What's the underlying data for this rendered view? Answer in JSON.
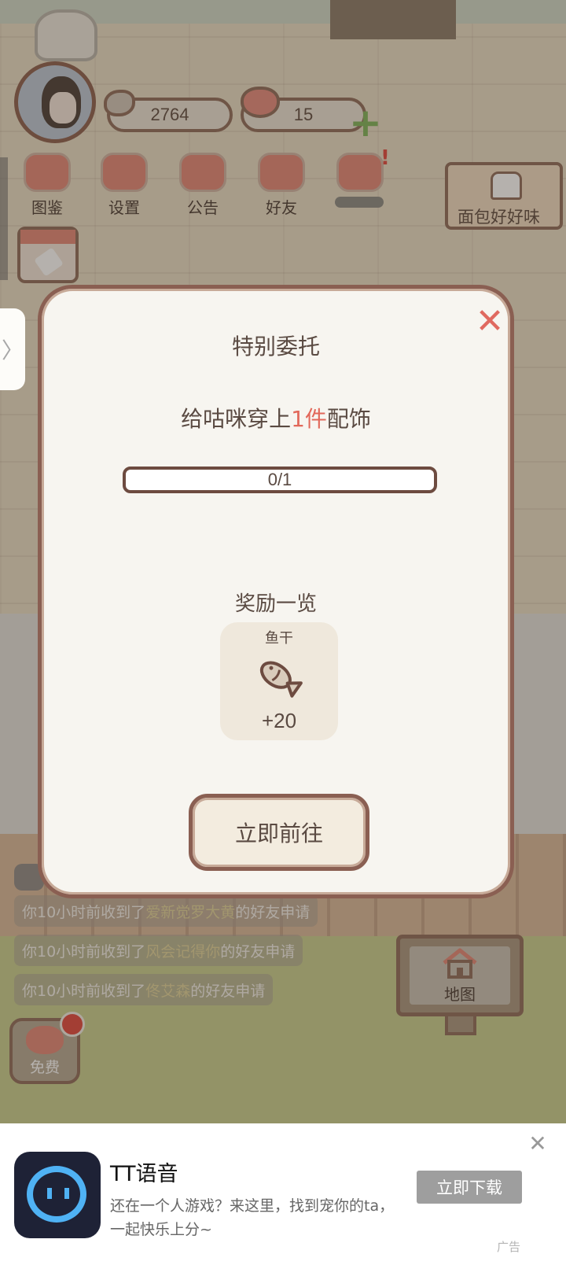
{
  "hud": {
    "fish_count": "2764",
    "heart_count": "15",
    "menu": [
      {
        "label": "图鉴"
      },
      {
        "label": "设置"
      },
      {
        "label": "公告"
      },
      {
        "label": "好友"
      }
    ],
    "shop_sign": "面包好好味",
    "side_tab": "〉"
  },
  "notices": [
    {
      "prefix": "你10小时前收到了",
      "name": "爱新觉罗大黄",
      "suffix": "的好友申请"
    },
    {
      "prefix": "你10小时前收到了",
      "name": "风会记得你",
      "suffix": "的好友申请"
    },
    {
      "prefix": "你10小时前收到了",
      "name": "佟艾森",
      "suffix": "的好友申请"
    }
  ],
  "map_button": "地图",
  "free_button": "免费",
  "modal": {
    "title": "特别委托",
    "close": "✕",
    "task_prefix": "给咕咪穿上",
    "task_highlight": "1件",
    "task_suffix": "配饰",
    "progress_text": "0/1",
    "progress_fraction": 0,
    "reward_title": "奖励一览",
    "reward": {
      "name": "鱼干",
      "amount": "+20",
      "icon": "fish-icon"
    },
    "go_button": "立即前往"
  },
  "ad": {
    "title": "TT语音",
    "description": "还在一个人游戏？来这里，找到宠你的ta，一起快乐上分~",
    "button": "立即下载",
    "close": "✕",
    "label": "广告"
  },
  "colors": {
    "accent_red": "#e2685a",
    "border_brown": "#8a5f52",
    "modal_bg": "#f7f5f0"
  }
}
